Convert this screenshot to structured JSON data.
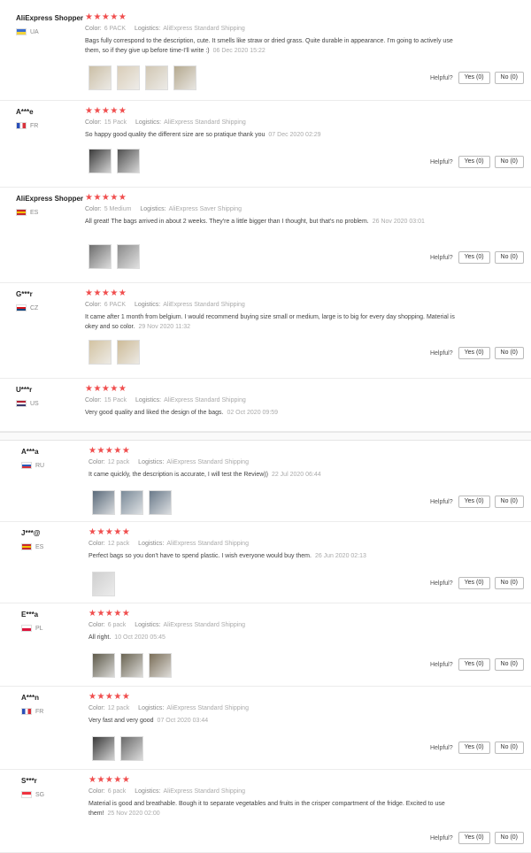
{
  "labels": {
    "helpful": "Helpful?",
    "yes": "Yes (0)",
    "no": "No (0)",
    "color_key": "Color:",
    "logistics_key": "Logistics:"
  },
  "colors": {
    "star": "#f04e4e"
  },
  "reviews": [
    {
      "user": "AliExpress Shopper",
      "country": "UA",
      "stars": "★★★★★",
      "color": "6 PACK",
      "logistics": "AliExpress Standard Shipping",
      "text": "Bags fully correspond to the description, cute. It smells like straw or dried grass. Quite durable in appearance. I'm going to actively use them, so if they give up before time-I'll write :)",
      "date": "06 Dec 2020 15:22",
      "thumb_colors": [
        "#cbbfa6",
        "#d9cdb8",
        "#d1c7b3",
        "#b5a98f"
      ],
      "flag_colors": [
        "#3b6fd1",
        "#f2d43a"
      ]
    },
    {
      "user": "A***e",
      "country": "FR",
      "stars": "★★★★★",
      "color": "15 Pack",
      "logistics": "AliExpress Standard Shipping",
      "text": "So happy good quality the different size are so pratique thank you",
      "date": "07 Dec 2020 02:29",
      "thumb_colors": [
        "#3a3a3a",
        "#505050"
      ],
      "flag_colors": [
        "#2a4fb8",
        "#ffffff",
        "#d8323c"
      ]
    },
    {
      "user": "AliExpress Shopper",
      "country": "ES",
      "stars": "★★★★★",
      "color": "5 Medium",
      "logistics": "AliExpress Saver Shipping",
      "text": "All great! The bags arrived in about 2 weeks. They're a little bigger than I thought, but that's no problem.",
      "date": "26 Nov 2020 03:01",
      "thumb_colors": [
        "#6d6d6d",
        "#8a8a8a"
      ],
      "flag_colors": [
        "#c8282e",
        "#f2c200",
        "#c8282e"
      ]
    },
    {
      "user": "G***r",
      "country": "CZ",
      "stars": "★★★★★",
      "color": "6 PACK",
      "logistics": "AliExpress Standard Shipping",
      "text": "It came after 1 month from belgium. I would recommend buying size small or medium, large is to big for every day shopping. Material is okey and so color.",
      "date": "29 Nov 2020 11:32",
      "thumb_colors": [
        "#d3c3a2",
        "#cdbb98"
      ],
      "flag_colors": [
        "#ffffff",
        "#d7141a",
        "#11457e"
      ]
    },
    {
      "user": "U***r",
      "country": "US",
      "stars": "★★★★★",
      "color": "15 Pack",
      "logistics": "AliExpress Standard Shipping",
      "text": "Very good quality and liked the design of the bags.",
      "date": "02 Oct 2020 09:59",
      "thumb_colors": [],
      "flag_colors": [
        "#b22234",
        "#ffffff",
        "#3c3b6e"
      ]
    },
    {
      "user": "A***a",
      "country": "RU",
      "stars": "★★★★★",
      "color": "12 pack",
      "logistics": "AliExpress Standard Shipping",
      "text": "It came quickly, the description is accurate, I will test the Review))",
      "date": "22 Jul 2020 06:44",
      "thumb_colors": [
        "#5a6a7a",
        "#7a8a98",
        "#6a7a8a"
      ],
      "flag_colors": [
        "#ffffff",
        "#2a5bb8",
        "#d8323c"
      ]
    },
    {
      "user": "J***@",
      "country": "ES",
      "stars": "★★★★★",
      "color": "12 pack",
      "logistics": "AliExpress Standard Shipping",
      "text": "Perfect bags so you don't have to spend plastic. I wish everyone would buy them.",
      "date": "26 Jun 2020 02:13",
      "thumb_colors": [
        "#cfcfcf"
      ],
      "flag_colors": [
        "#c8282e",
        "#f2c200",
        "#c8282e"
      ]
    },
    {
      "user": "E***a",
      "country": "PL",
      "stars": "★★★★★",
      "color": "6 pack",
      "logistics": "AliExpress Standard Shipping",
      "text": "All right.",
      "date": "10 Oct 2020 05:45",
      "thumb_colors": [
        "#5e5a4a",
        "#6a6452",
        "#7a6e58"
      ],
      "flag_colors": [
        "#ffffff",
        "#dc143c"
      ]
    },
    {
      "user": "A***n",
      "country": "FR",
      "stars": "★★★★★",
      "color": "12 pack",
      "logistics": "AliExpress Standard Shipping",
      "text": "Very fast and very good",
      "date": "07 Oct 2020 03:44",
      "thumb_colors": [
        "#3a3a3a",
        "#6a6a6a"
      ],
      "flag_colors": [
        "#2a4fb8",
        "#ffffff",
        "#d8323c"
      ]
    },
    {
      "user": "S***r",
      "country": "SG",
      "stars": "★★★★★",
      "color": "6 pack",
      "logistics": "AliExpress Standard Shipping",
      "text": "Material is good and breathable. Bough it to separate vegetables and fruits in the crisper compartment of the fridge. Excited to use them!",
      "date": "25 Nov 2020 02:00",
      "thumb_colors": [],
      "flag_colors": [
        "#ef3340",
        "#ffffff"
      ]
    }
  ]
}
